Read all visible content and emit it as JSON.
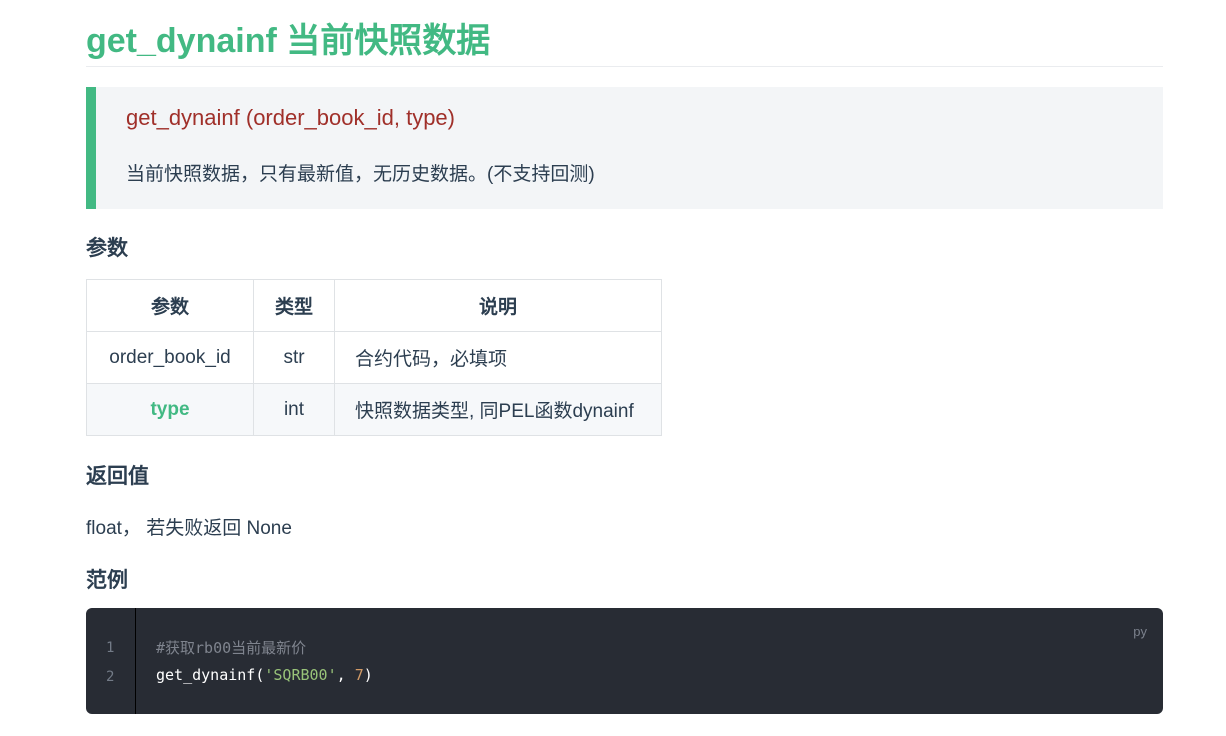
{
  "title": "get_dynainf 当前快照数据",
  "signature": {
    "text": "get_dynainf (order_book_id, type)",
    "description": "当前快照数据，只有最新值，无历史数据。(不支持回测)"
  },
  "params_heading": "参数",
  "params_table": {
    "headers": [
      "参数",
      "类型",
      "说明"
    ],
    "rows": [
      [
        "order_book_id",
        "str",
        "合约代码，必填项"
      ],
      [
        "type",
        "int",
        "快照数据类型, 同PEL函数dynainf"
      ]
    ]
  },
  "return_heading": "返回值",
  "return_text": "float， 若失败返回 None",
  "example_heading": "范例",
  "code": {
    "lang": "py",
    "line_numbers": [
      "1",
      "2"
    ],
    "comment": "#获取rb00当前最新价",
    "fn": "get_dynainf(",
    "str": "'SQRB00'",
    "sep": ", ",
    "num": "7",
    "close": ")"
  },
  "colors": {
    "accent": "#42b983",
    "signature": "#a0302a",
    "code_bg": "#282c34",
    "string": "#98c379",
    "number": "#d19a66"
  }
}
